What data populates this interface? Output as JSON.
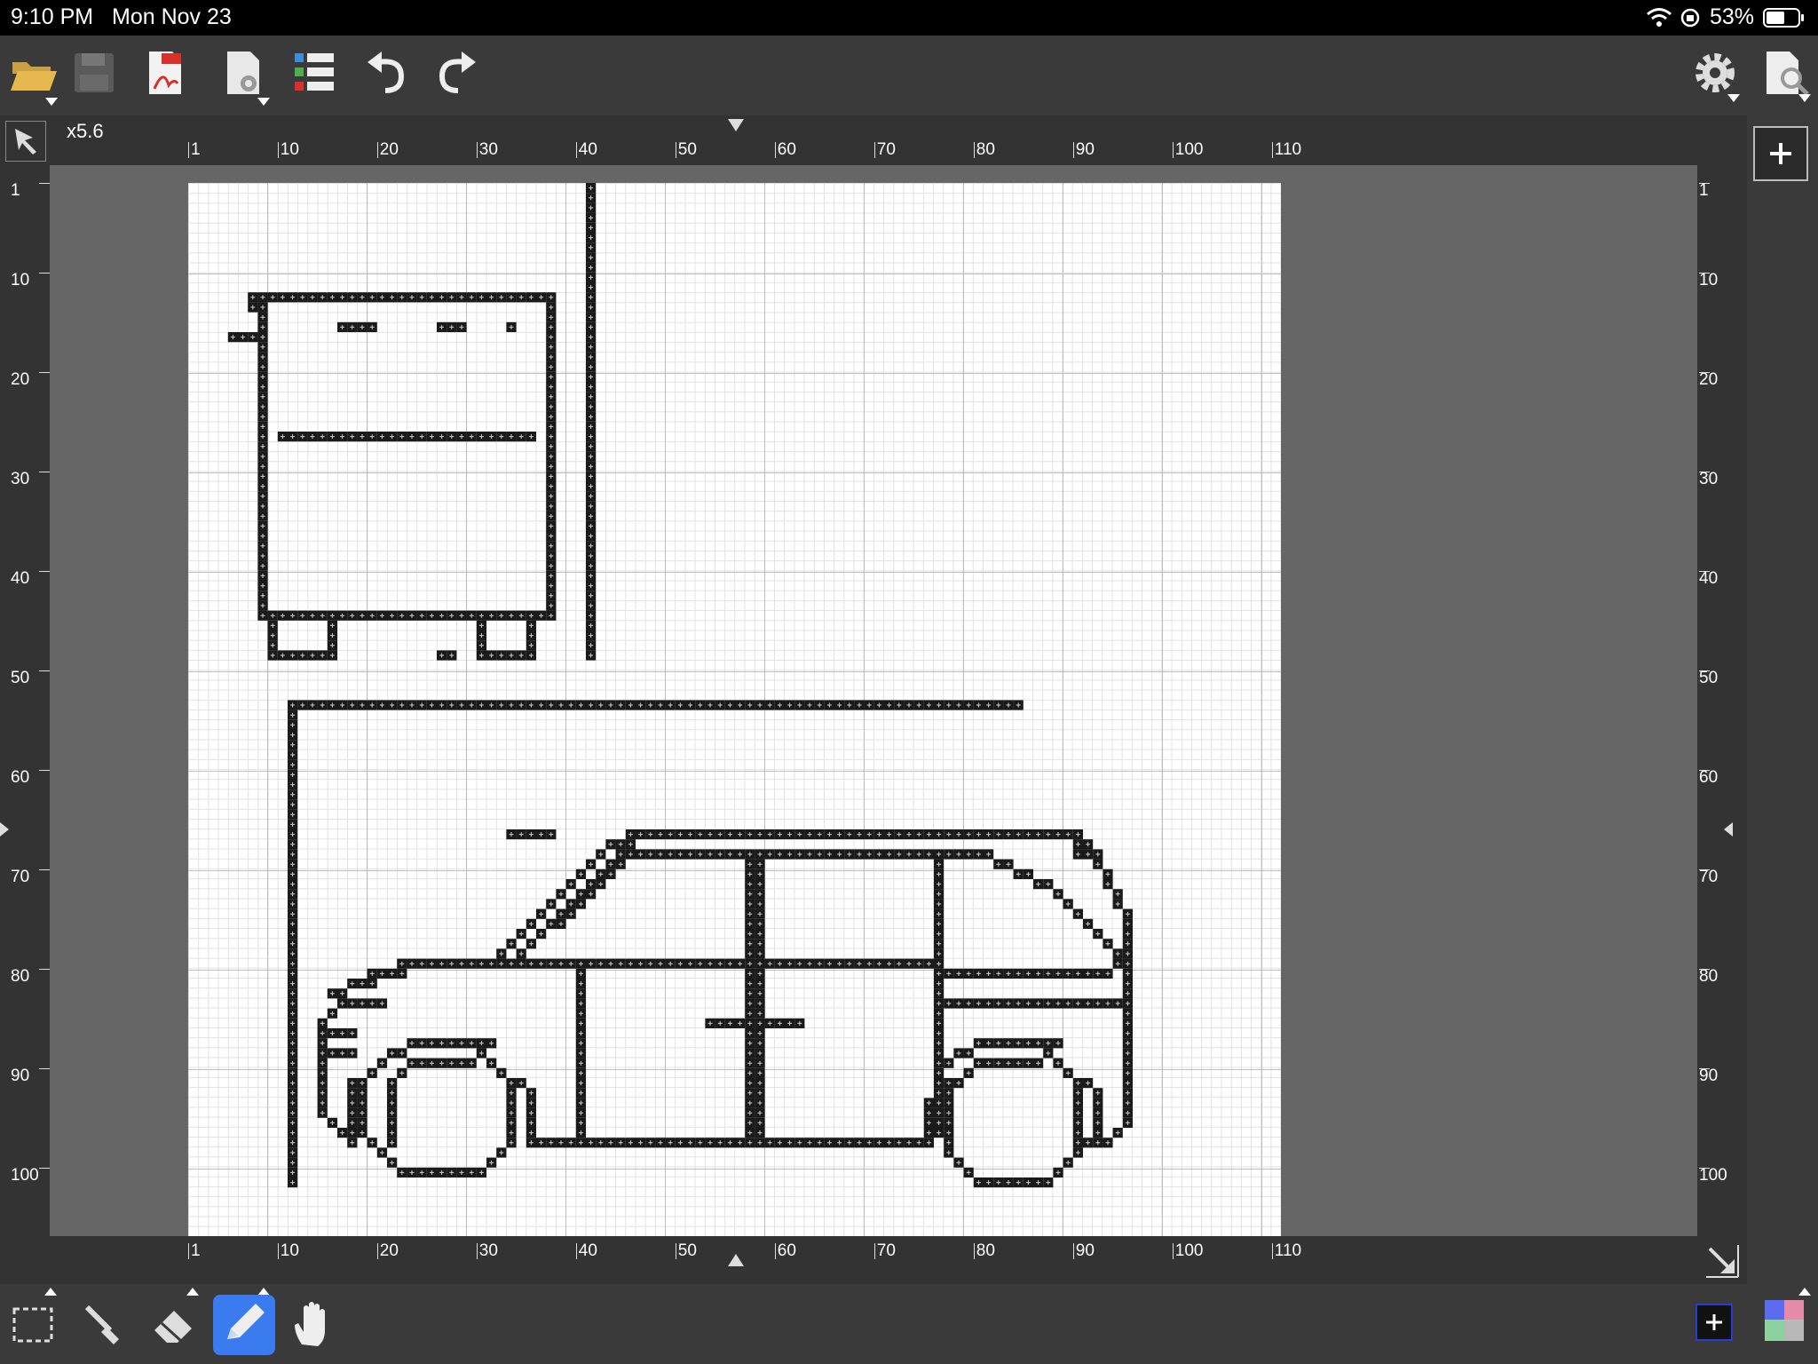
{
  "status": {
    "time": "9:10 PM",
    "date": "Mon Nov 23",
    "battery": "53%"
  },
  "toolbar": {
    "icons": [
      "folder-open-icon",
      "save-icon",
      "pdf-export-icon",
      "page-settings-icon",
      "list-icon",
      "undo-icon",
      "redo-icon",
      "settings-gear-icon",
      "zoom-page-icon"
    ]
  },
  "canvas": {
    "zoom": "x5.6",
    "ruler_x": [
      "1",
      "10",
      "20",
      "30",
      "40",
      "50",
      "60",
      "70",
      "80",
      "90",
      "100",
      "110"
    ],
    "ruler_y": [
      "1",
      "10",
      "20",
      "30",
      "40",
      "50",
      "60",
      "70",
      "80",
      "90",
      "100"
    ],
    "grid_columns": 110,
    "grid_rows": 105
  },
  "tools": [
    "marquee-select-icon",
    "eyedropper-icon",
    "eraser-icon",
    "pencil-icon",
    "hand-pan-icon"
  ],
  "active_tool": "pencil",
  "drawing": {
    "segments": [
      [
        7,
        12,
        37,
        12
      ],
      [
        7,
        12,
        7,
        13
      ],
      [
        8,
        13,
        8,
        44
      ],
      [
        37,
        12,
        37,
        44
      ],
      [
        5,
        16,
        8,
        16
      ],
      [
        16,
        15,
        19,
        15
      ],
      [
        26,
        15,
        28,
        15
      ],
      [
        33,
        15,
        33,
        15
      ],
      [
        10,
        26,
        35,
        26
      ],
      [
        8,
        44,
        37,
        44
      ],
      [
        9,
        45,
        9,
        47
      ],
      [
        9,
        48,
        15,
        48
      ],
      [
        15,
        45,
        15,
        48
      ],
      [
        35,
        45,
        35,
        48
      ],
      [
        30,
        48,
        35,
        48
      ],
      [
        30,
        45,
        30,
        48
      ],
      [
        26,
        48,
        27,
        48
      ],
      [
        41,
        1,
        41,
        48
      ],
      [
        11,
        53,
        84,
        53
      ],
      [
        11,
        53,
        11,
        101
      ],
      [
        33,
        66,
        37,
        66
      ],
      [
        45,
        66,
        90,
        66
      ],
      [
        44,
        67,
        44,
        67
      ],
      [
        90,
        67,
        91,
        68
      ],
      [
        43,
        67,
        43,
        67
      ],
      [
        42,
        68,
        42,
        68
      ],
      [
        41,
        69,
        41,
        69
      ],
      [
        40,
        70,
        40,
        70
      ],
      [
        39,
        71,
        39,
        71
      ],
      [
        38,
        72,
        38,
        72
      ],
      [
        37,
        73,
        37,
        73
      ],
      [
        36,
        74,
        36,
        74
      ],
      [
        35,
        75,
        35,
        75
      ],
      [
        34,
        76,
        34,
        76
      ],
      [
        33,
        77,
        33,
        77
      ],
      [
        32,
        78,
        32,
        78
      ],
      [
        31,
        79,
        31,
        79
      ],
      [
        45,
        67,
        45,
        67
      ],
      [
        44,
        68,
        44,
        68
      ],
      [
        43,
        69,
        43,
        69
      ],
      [
        42,
        70,
        42,
        70
      ],
      [
        41,
        71,
        41,
        71
      ],
      [
        40,
        72,
        40,
        72
      ],
      [
        39,
        73,
        39,
        73
      ],
      [
        38,
        74,
        38,
        74
      ],
      [
        37,
        75,
        37,
        75
      ],
      [
        36,
        76,
        36,
        76
      ],
      [
        35,
        77,
        35,
        77
      ],
      [
        34,
        78,
        34,
        78
      ],
      [
        33,
        79,
        33,
        79
      ],
      [
        45,
        68,
        81,
        68
      ],
      [
        44,
        69,
        44,
        69
      ],
      [
        43,
        70,
        43,
        70
      ],
      [
        42,
        71,
        42,
        71
      ],
      [
        41,
        72,
        41,
        72
      ],
      [
        40,
        73,
        40,
        73
      ],
      [
        39,
        74,
        39,
        74
      ],
      [
        38,
        75,
        38,
        75
      ],
      [
        57,
        68,
        57,
        97
      ],
      [
        58,
        68,
        58,
        97
      ],
      [
        76,
        69,
        76,
        96
      ],
      [
        82,
        69,
        83,
        69
      ],
      [
        84,
        70,
        85,
        70
      ],
      [
        86,
        71,
        87,
        71
      ],
      [
        88,
        72,
        88,
        72
      ],
      [
        89,
        73,
        89,
        73
      ],
      [
        90,
        74,
        90,
        74
      ],
      [
        91,
        75,
        91,
        75
      ],
      [
        92,
        76,
        92,
        76
      ],
      [
        93,
        77,
        93,
        77
      ],
      [
        94,
        78,
        94,
        79
      ],
      [
        92,
        68,
        92,
        69
      ],
      [
        93,
        70,
        93,
        71
      ],
      [
        94,
        72,
        94,
        73
      ],
      [
        95,
        74,
        95,
        95
      ],
      [
        94,
        96,
        94,
        96
      ],
      [
        92,
        97,
        93,
        97
      ],
      [
        91,
        97,
        91,
        97
      ],
      [
        22,
        79,
        76,
        79
      ],
      [
        19,
        80,
        22,
        80
      ],
      [
        17,
        81,
        19,
        81
      ],
      [
        15,
        82,
        16,
        82
      ],
      [
        16,
        83,
        20,
        83
      ],
      [
        15,
        84,
        15,
        84
      ],
      [
        14,
        85,
        14,
        85
      ],
      [
        14,
        86,
        14,
        94
      ],
      [
        15,
        86,
        17,
        86
      ],
      [
        15,
        88,
        17,
        88
      ],
      [
        15,
        95,
        15,
        95
      ],
      [
        16,
        96,
        17,
        96
      ],
      [
        17,
        91,
        17,
        97
      ],
      [
        76,
        80,
        93,
        80
      ],
      [
        77,
        83,
        95,
        83
      ],
      [
        53,
        85,
        62,
        85
      ],
      [
        40,
        79,
        40,
        97
      ],
      [
        36,
        97,
        75,
        97
      ],
      [
        75,
        93,
        75,
        97
      ],
      [
        23,
        87,
        31,
        87
      ],
      [
        21,
        88,
        22,
        88
      ],
      [
        23,
        89,
        29,
        89
      ],
      [
        20,
        89,
        20,
        89
      ],
      [
        19,
        90,
        19,
        90
      ],
      [
        18,
        91,
        18,
        96
      ],
      [
        19,
        97,
        19,
        97
      ],
      [
        20,
        98,
        20,
        98
      ],
      [
        21,
        99,
        21,
        99
      ],
      [
        22,
        100,
        30,
        100
      ],
      [
        31,
        99,
        31,
        99
      ],
      [
        32,
        98,
        32,
        98
      ],
      [
        33,
        97,
        33,
        91
      ],
      [
        32,
        90,
        32,
        90
      ],
      [
        31,
        89,
        31,
        89
      ],
      [
        30,
        88,
        30,
        88
      ],
      [
        34,
        91,
        34,
        91
      ],
      [
        35,
        92,
        35,
        97
      ],
      [
        21,
        91,
        21,
        97
      ],
      [
        22,
        90,
        22,
        90
      ],
      [
        80,
        87,
        88,
        87
      ],
      [
        78,
        88,
        79,
        88
      ],
      [
        80,
        89,
        86,
        89
      ],
      [
        77,
        89,
        77,
        89
      ],
      [
        76,
        90,
        76,
        90
      ],
      [
        77,
        91,
        77,
        98
      ],
      [
        78,
        99,
        78,
        99
      ],
      [
        79,
        100,
        79,
        100
      ],
      [
        80,
        101,
        87,
        101
      ],
      [
        88,
        100,
        88,
        100
      ],
      [
        89,
        99,
        89,
        99
      ],
      [
        90,
        98,
        90,
        91
      ],
      [
        89,
        90,
        89,
        90
      ],
      [
        88,
        89,
        88,
        89
      ],
      [
        87,
        88,
        87,
        88
      ],
      [
        91,
        91,
        91,
        91
      ],
      [
        92,
        92,
        92,
        97
      ],
      [
        79,
        90,
        79,
        90
      ],
      [
        78,
        91,
        78,
        91
      ]
    ]
  }
}
